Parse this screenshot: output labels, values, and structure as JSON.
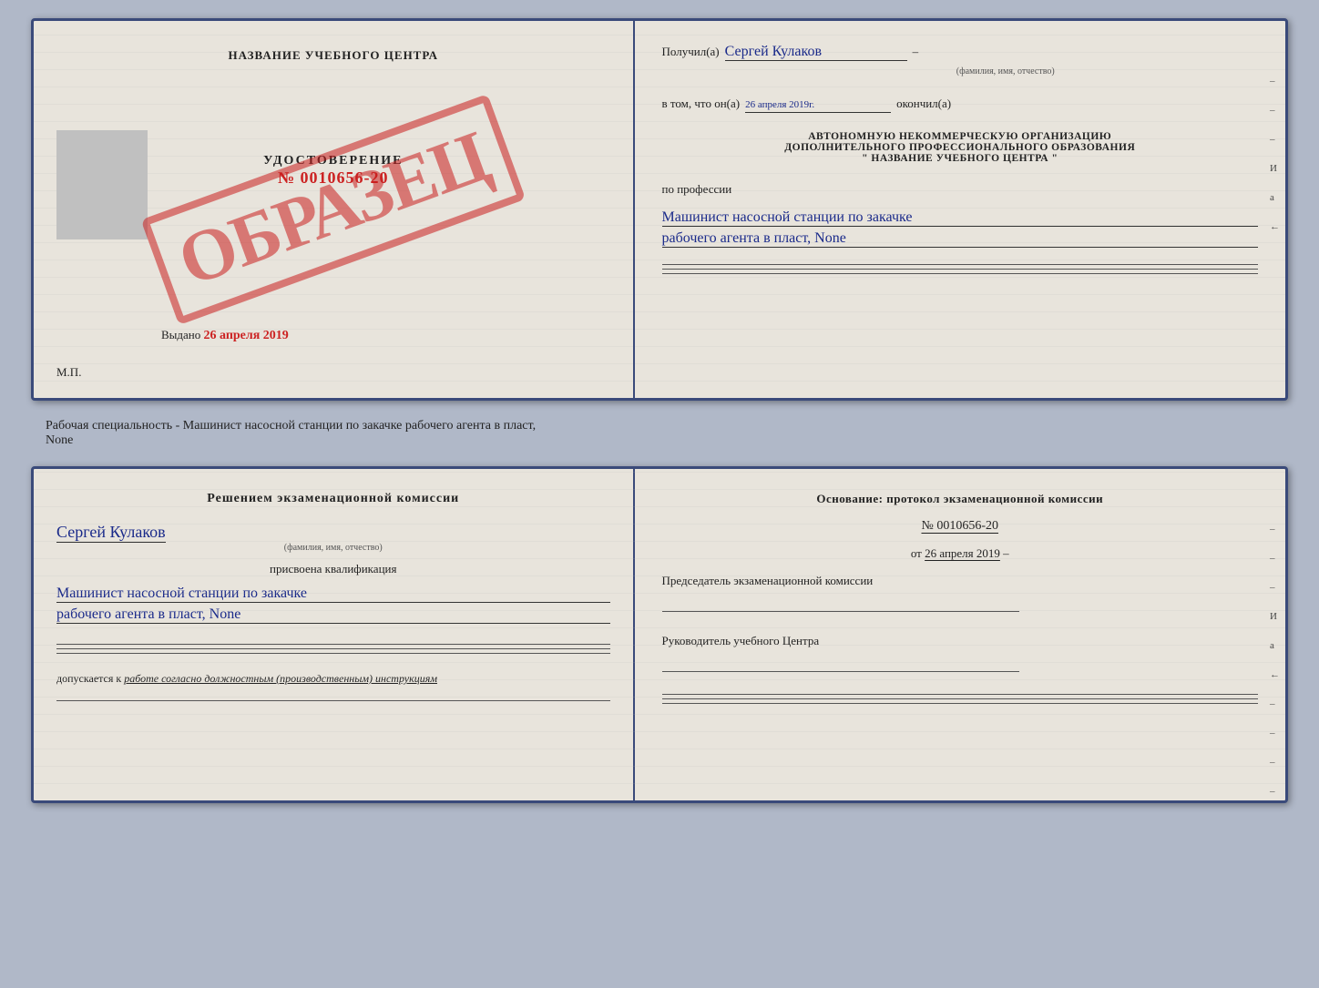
{
  "doc1": {
    "left": {
      "title": "НАЗВАНИЕ УЧЕБНОГО ЦЕНТРА",
      "stamp": "ОБРАЗЕЦ",
      "photo_alt": "фото",
      "udostoverenie_label": "УДОСТОВЕРЕНИЕ",
      "udostoverenie_number": "№ 0010656-20",
      "vydano_label": "Выдано",
      "vydano_date": "26 апреля 2019",
      "mp_label": "М.П."
    },
    "right": {
      "poluchil_label": "Получил(а)",
      "poluchil_name": "Сергей Кулаков",
      "familiya_label": "(фамилия, имя, отчество)",
      "vtom_label": "в том, что он(а)",
      "vtom_date": "26 апреля 2019г.",
      "okonchil_label": "окончил(а)",
      "org_line1": "АВТОНОМНУЮ НЕКОММЕРЧЕСКУЮ ОРГАНИЗАЦИЮ",
      "org_line2": "ДОПОЛНИТЕЛЬНОГО ПРОФЕССИОНАЛЬНОГО ОБРАЗОВАНИЯ",
      "org_line3": "\"  НАЗВАНИЕ УЧЕБНОГО ЦЕНТРА  \"",
      "po_professii_label": "по профессии",
      "profession_line1": "Машинист насосной станции по закачке",
      "profession_line2": "рабочего агента в пласт, None",
      "dash_marks": [
        "–",
        "–",
        "–",
        "–",
        "–",
        "–",
        "–"
      ]
    }
  },
  "between": {
    "text": "Рабочая специальность - Машинист насосной станции по закачке рабочего агента в пласт,",
    "text2": "None"
  },
  "doc2": {
    "left": {
      "komissia_title": "Решением экзаменационной комиссии",
      "name": "Сергей Кулаков",
      "familiya_label": "(фамилия, имя, отчество)",
      "prisvoena_label": "присвоена квалификация",
      "profession_line1": "Машинист насосной станции по закачке",
      "profession_line2": "рабочего агента в пласт, None",
      "dopuskaetsya_label": "допускается к",
      "dopuskaetsya_text": "работе согласно должностным (производственным) инструкциям"
    },
    "right": {
      "osnovaniye_label": "Основание: протокол экзаменационной комиссии",
      "number": "№ 0010656-20",
      "ot_label": "от",
      "ot_date": "26 апреля 2019",
      "predsedatel_label": "Председатель экзаменационной комиссии",
      "rukovoditel_label": "Руководитель учебного Центра",
      "dash_marks": [
        "–",
        "–",
        "–",
        "И",
        "а",
        "←",
        "–",
        "–",
        "–",
        "–"
      ]
    }
  }
}
